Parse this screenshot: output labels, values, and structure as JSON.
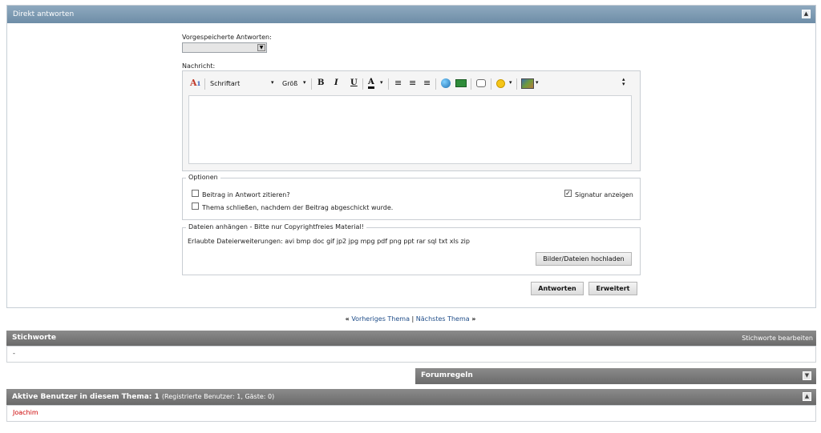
{
  "panel": {
    "title": "Direkt antworten",
    "collapse_icon": "▲"
  },
  "saved_replies": {
    "label": "Vorgespeicherte Antworten:",
    "selected": ""
  },
  "message": {
    "label": "Nachricht:",
    "text": ""
  },
  "toolbar": {
    "font_label": "Schriftart",
    "size_label": "Größ",
    "bold": "B",
    "italic": "I",
    "underline": "U",
    "color": "A",
    "icons": [
      "remove-format-icon",
      "align-left-icon",
      "align-center-icon",
      "align-right-icon",
      "insert-link-icon",
      "unlink-icon",
      "quote-icon",
      "smilie-icon",
      "insert-image-icon",
      "resize-icon"
    ]
  },
  "options": {
    "legend": "Optionen",
    "quote_post": {
      "label": "Beitrag in Antwort zitieren?",
      "checked": false
    },
    "close_thread": {
      "label": "Thema schließen, nachdem der Beitrag abgeschickt wurde.",
      "checked": false
    },
    "show_signature": {
      "label": "Signatur anzeigen",
      "checked": true
    }
  },
  "attachments": {
    "legend": "Dateien anhängen - Bitte nur Copyrightfreies Material!",
    "allowed": "Erlaubte Dateierweiterungen: avi bmp doc gif jp2 jpg mpg pdf png ppt rar sql txt xls zip",
    "upload_button": "Bilder/Dateien hochladen"
  },
  "actions": {
    "reply": "Antworten",
    "advanced": "Erweitert"
  },
  "nav": {
    "prev_arrow": "«",
    "prev": "Vorheriges Thema",
    "separator": "|",
    "next": "Nächstes Thema",
    "next_arrow": "»"
  },
  "tags": {
    "title": "Stichworte",
    "edit": "Stichworte bearbeiten",
    "value": "-"
  },
  "rules": {
    "title": "Forumregeln",
    "toggle_icon": "▼"
  },
  "active_users": {
    "title": "Aktive Benutzer in diesem Thema: 1",
    "detail": "(Registrierte Benutzer: 1, Gäste: 0)",
    "toggle_icon": "▲",
    "users": [
      "Joachim"
    ]
  },
  "colors": {
    "header_blue": "#7a97af",
    "header_dark": "#7a7a7a",
    "link": "#224f8a",
    "user": "#cc0000"
  }
}
